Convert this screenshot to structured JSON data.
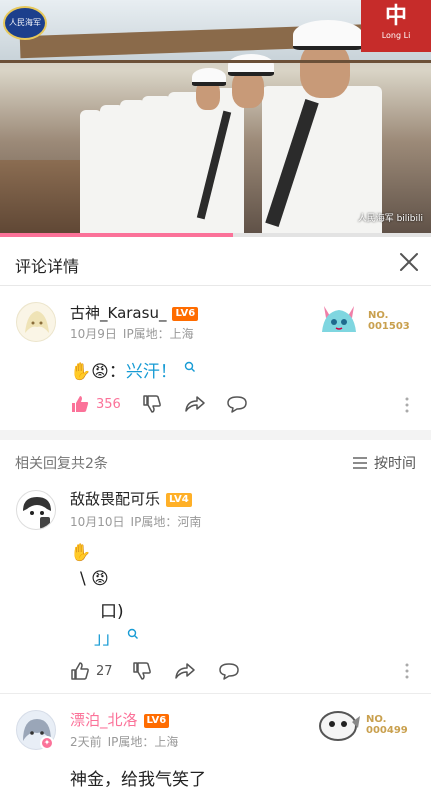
{
  "video": {
    "logo_text": "人民海军",
    "banner_text": "中",
    "banner_sub": "Long Li",
    "watermark": "人民海军 bilibili",
    "progress": 0.54
  },
  "header": {
    "title": "评论详情"
  },
  "main_comment": {
    "username": "古神_Karasu_",
    "level": "LV6",
    "date": "10月9日",
    "ip": "IP属地：上海",
    "text_prefix": "✋😡：",
    "text_link": "兴汗！",
    "likes": "356",
    "fan_no_label": "NO.",
    "fan_no": "001503"
  },
  "replies_header": {
    "label": "相关回复共2条",
    "sort": "按时间"
  },
  "reply1": {
    "username": "敌敌畏配可乐",
    "level": "LV4",
    "date": "10月10日",
    "ip": "IP属地：河南",
    "line1": "✋",
    "line2": "\\ 😡",
    "line3": "口)",
    "line4": "」」",
    "likes": "27"
  },
  "reply2": {
    "username": "漂泊_北洛",
    "level": "LV6",
    "date": "2天前",
    "ip": "IP属地：上海",
    "text": "神金，给我气笑了",
    "fan_no_label": "NO.",
    "fan_no": "000499"
  },
  "colors": {
    "accent": "#fb7299",
    "link": "#179bd4",
    "vip_name": "#fb7299",
    "level6": "#ff6c00",
    "level4": "#ffb027"
  }
}
